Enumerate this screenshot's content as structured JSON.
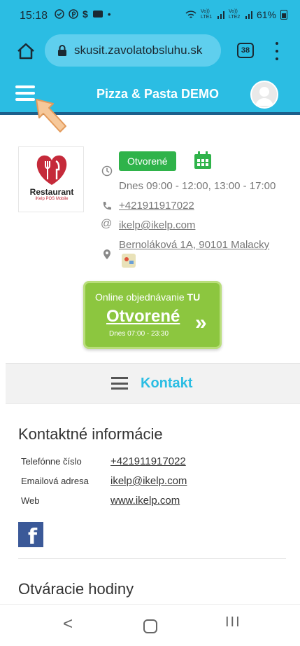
{
  "status_bar": {
    "time": "15:18",
    "battery": "61%",
    "signal_text_1": "Vo)) LTE1",
    "signal_text_2": "Vo)) LTE2"
  },
  "browser": {
    "url": "skusit.zavolatobsluhu.sk",
    "tab_count": "38"
  },
  "header": {
    "title": "Pizza & Pasta DEMO"
  },
  "restaurant": {
    "logo_text": "Restaurant",
    "logo_sub": "iKelp POS Mobile",
    "status_badge": "Otvorené",
    "hours_today": "Dnes 09:00 - 12:00, 13:00 - 17:00",
    "phone": "+421911917022",
    "email": "ikelp@ikelp.com",
    "address": "Bernoláková 1A, 90101 Malacky"
  },
  "order_button": {
    "line1": "Online objednávanie",
    "line1_strong": "TU",
    "status": "Otvorené",
    "hours": "Dnes 07:00 - 23:30",
    "chevron": "»"
  },
  "kontakt": {
    "title": "Kontakt"
  },
  "contact_info": {
    "section_title": "Kontaktné informácie",
    "rows": [
      {
        "label": "Telefónne číslo",
        "value": "+421911917022"
      },
      {
        "label": "Emailová adresa",
        "value": "ikelp@ikelp.com"
      },
      {
        "label": "Web",
        "value": "www.ikelp.com"
      }
    ],
    "facebook_glyph": "f"
  },
  "opening_hours": {
    "section_title": "Otváracie hodiny"
  },
  "nav": {
    "back": "<",
    "recent": "III"
  },
  "colors": {
    "brand": "#2bbde3",
    "open_green": "#2fb34a",
    "order_green": "#8cc63f"
  }
}
